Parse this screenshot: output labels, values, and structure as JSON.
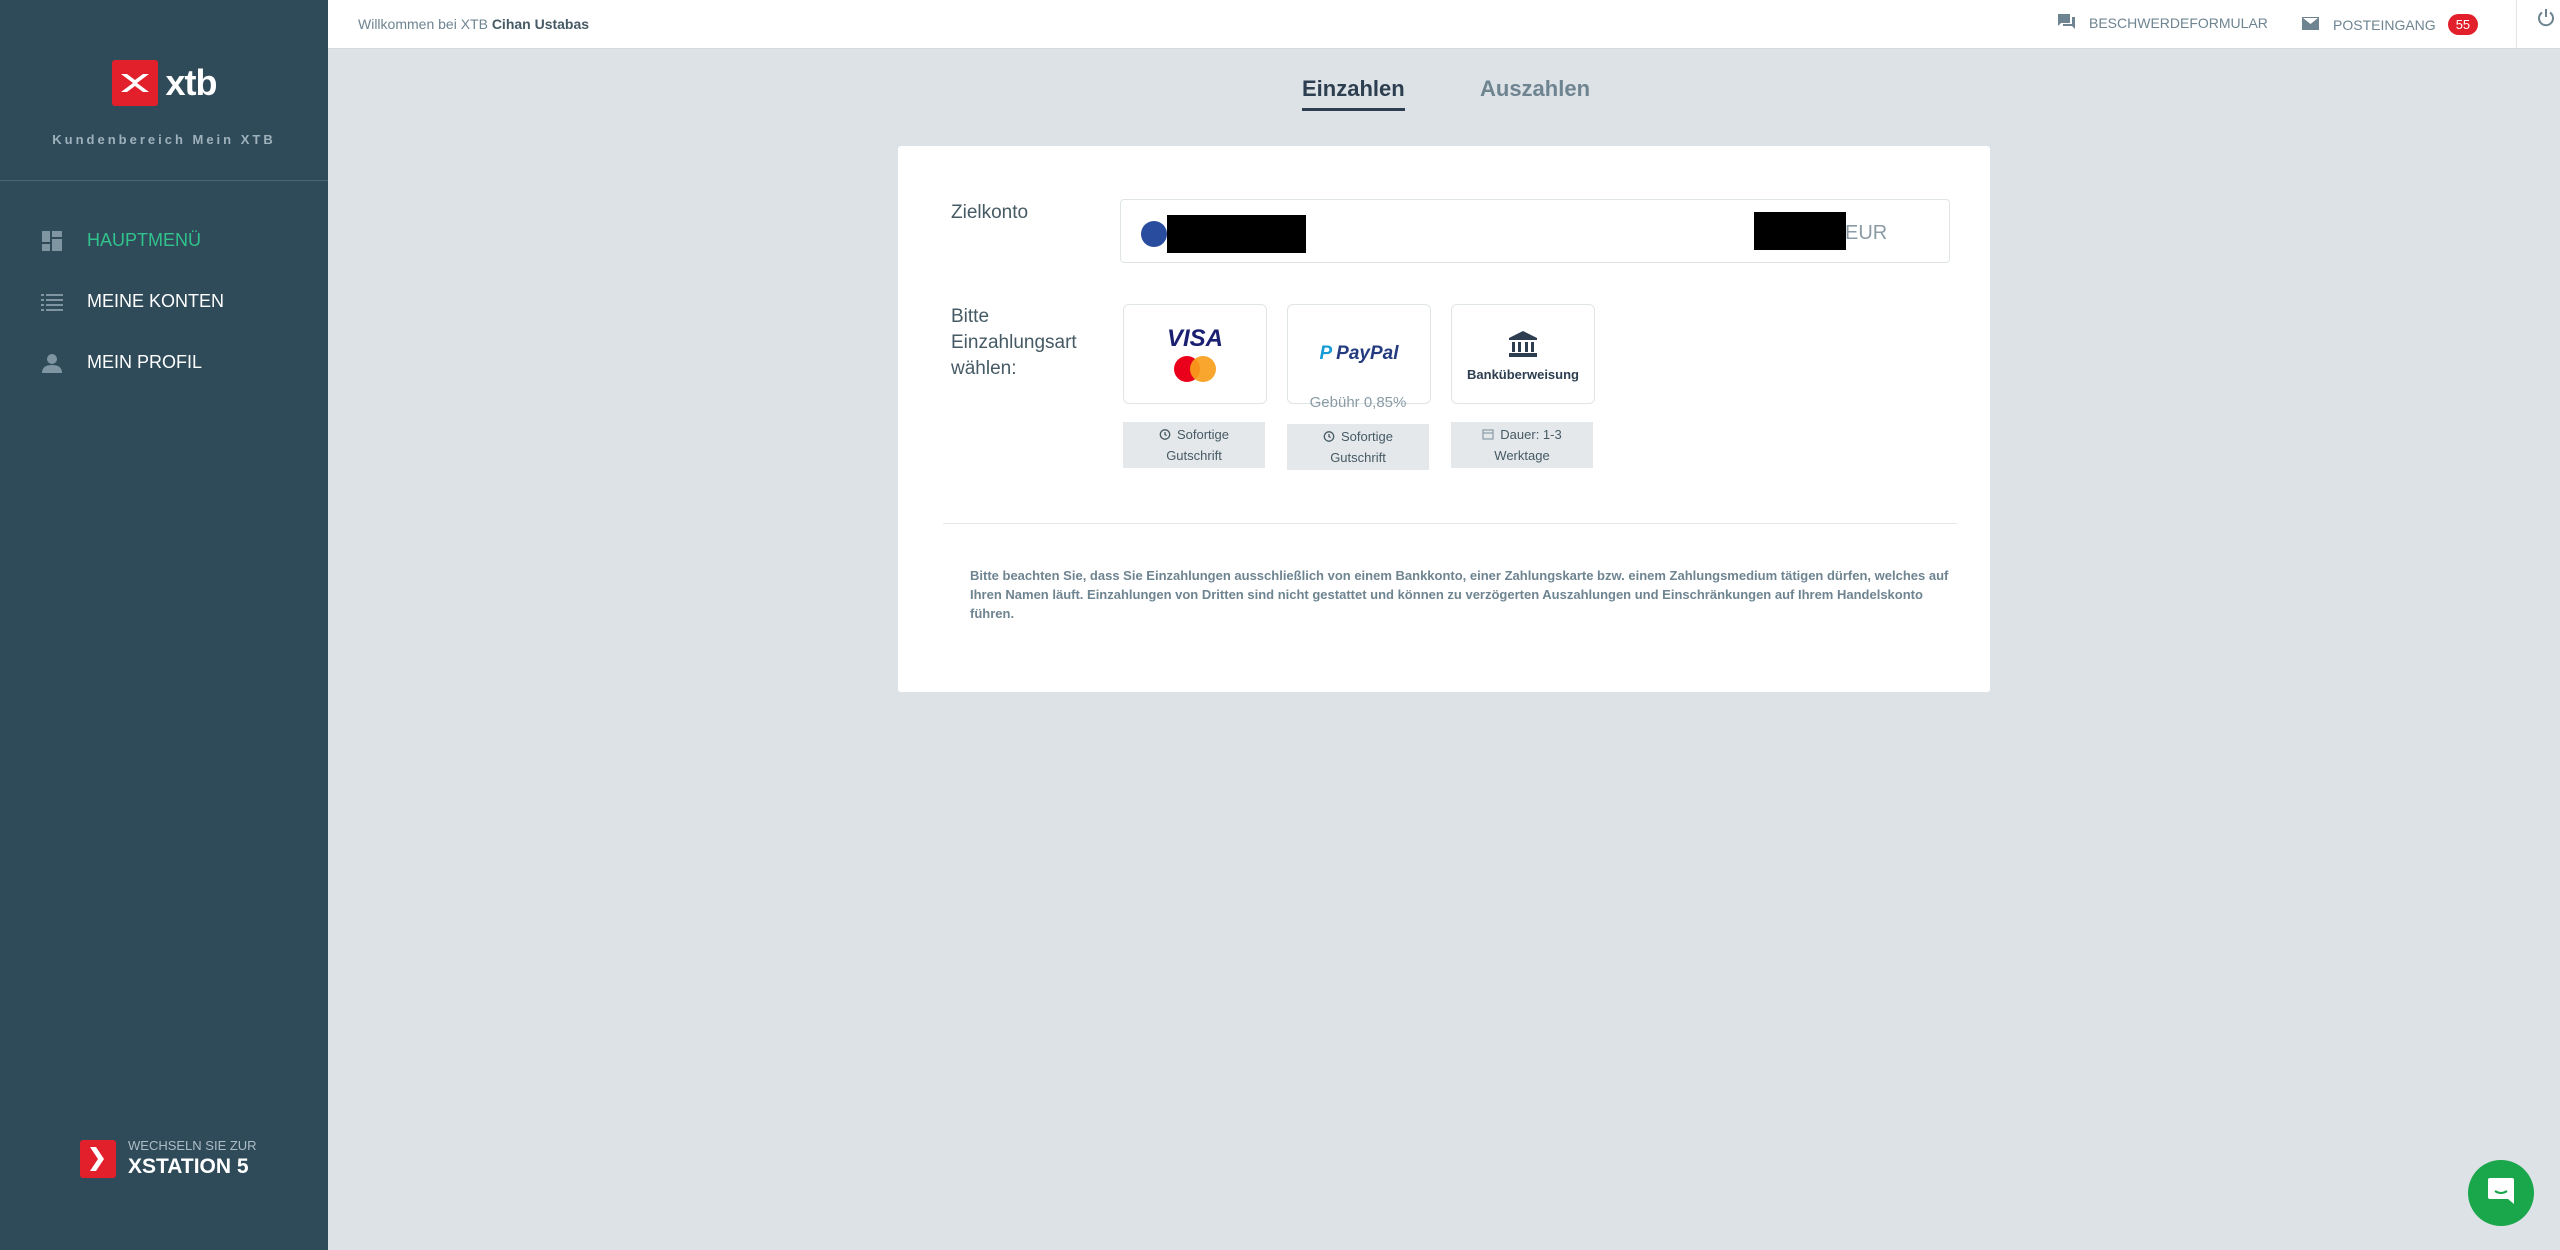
{
  "brand": {
    "logo_text": "xtb",
    "subtitle": "Kundenbereich Mein XTB",
    "red": "#e2202c",
    "sidebar_bg": "#2f4b5a",
    "active_green": "#31c38b"
  },
  "sidebar": {
    "items": [
      {
        "label": "HAUPTMENÜ",
        "icon": "dashboard-icon",
        "active": true
      },
      {
        "label": "MEINE KONTEN",
        "icon": "list-icon",
        "active": false
      },
      {
        "label": "MEIN PROFIL",
        "icon": "person-icon",
        "active": false
      }
    ],
    "xstation": {
      "small": "WECHSELN SIE ZUR",
      "big": "XSTATION 5"
    }
  },
  "topbar": {
    "welcome_prefix": "Willkommen bei XTB",
    "user_name": "Cihan Ustabas",
    "complaint": "BESCHWERDEFORMULAR",
    "inbox": "POSTEINGANG",
    "inbox_count": "55"
  },
  "tabs": [
    {
      "label": "Einzahlen",
      "active": true
    },
    {
      "label": "Auszahlen",
      "active": false
    }
  ],
  "form": {
    "target_label": "Zielkonto",
    "currency": "EUR",
    "method_label_lines": [
      "Bitte",
      "Einzahlungsart",
      "wählen:"
    ],
    "methods": [
      {
        "name": "Visa / Mastercard",
        "visa_text": "VISA",
        "fee": "",
        "info_lines": [
          "Sofortige",
          "Gutschrift"
        ],
        "info_icon": "clock-icon"
      },
      {
        "name": "PayPal",
        "logo_text": "PayPal",
        "fee": "Gebühr 0,85%",
        "info_lines": [
          "Sofortige",
          "Gutschrift"
        ],
        "info_icon": "clock-icon"
      },
      {
        "name": "Banküberweisung",
        "logo_text": "Banküberweisung",
        "fee": "",
        "info_lines": [
          "Dauer: 1-3",
          "Werktage"
        ],
        "info_icon": "calendar-icon"
      }
    ],
    "notice": "Bitte beachten Sie, dass Sie Einzahlungen ausschließlich von einem Bankkonto, einer Zahlungskarte bzw. einem Zahlungsmedium tätigen dürfen, welches auf Ihren Namen läuft. Einzahlungen von Dritten sind nicht gestattet und können zu verzögerten Auszahlungen und Einschränkungen auf Ihrem Handelskonto führen."
  }
}
